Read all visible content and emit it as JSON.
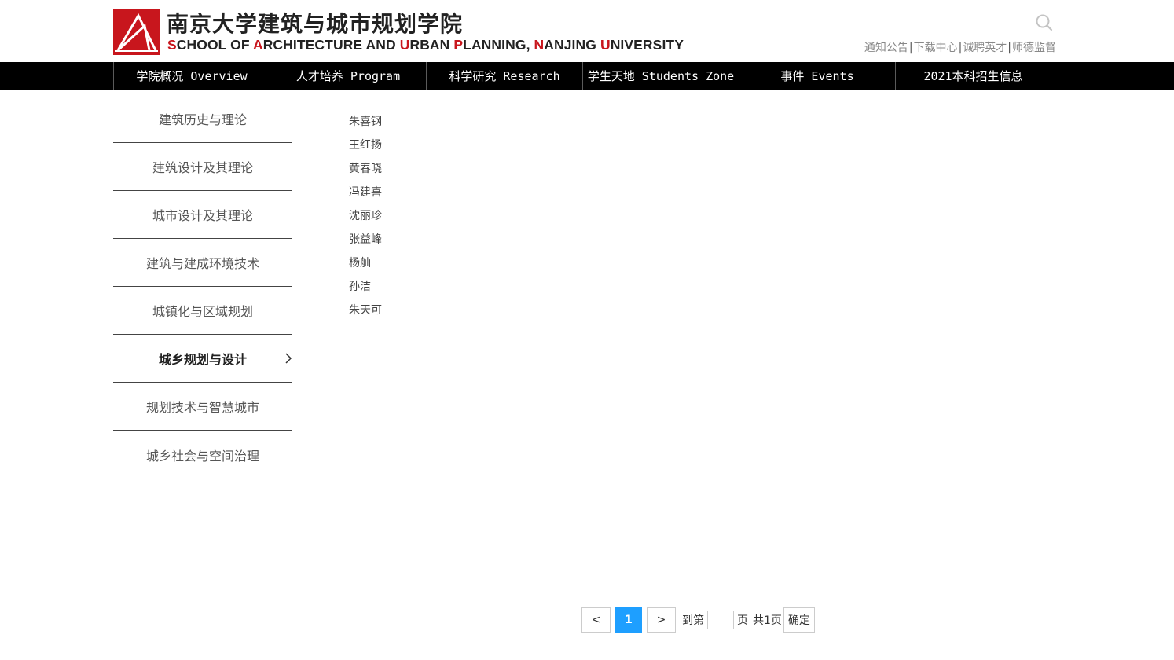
{
  "header": {
    "title_cn": "南京大学建筑与城市规划学院",
    "title_en": {
      "s": "S",
      "p1": "CHOOL OF ",
      "a": "A",
      "p2": "RCHITECTURE AND ",
      "u": "U",
      "p3": "RBAN ",
      "pl": "P",
      "p4": "LANNING, ",
      "n": "N",
      "p5": "ANJING ",
      "un": "U",
      "p6": "NIVERSITY"
    },
    "top_links": [
      "通知公告",
      "下载中心",
      "诚聘英才",
      "师德监督"
    ],
    "separator": "|"
  },
  "nav": {
    "items": [
      "学院概况 Overview",
      "人才培养 Program",
      "科学研究 Research",
      "学生天地 Students Zone",
      "事件 Events",
      "2021本科招生信息"
    ]
  },
  "sidebar": {
    "items": [
      "建筑历史与理论",
      "建筑设计及其理论",
      "城市设计及其理论",
      "建筑与建成环境技术",
      "城镇化与区域规划",
      "城乡规划与设计",
      "规划技术与智慧城市",
      "城乡社会与空间治理"
    ],
    "active_index": 5
  },
  "people": [
    "朱喜钢",
    "王红扬",
    "黄春晓",
    "冯建喜",
    "沈丽珍",
    "张益峰",
    "杨舢",
    "孙洁",
    "朱天可"
  ],
  "pager": {
    "prev": "<",
    "current": "1",
    "next": ">",
    "goto_prefix": "到第",
    "goto_suffix": "页",
    "total": "共1页",
    "confirm": "确定"
  },
  "colors": {
    "brand_red": "#c8161d",
    "nav_bg": "#000000",
    "pager_active": "#1e9fff"
  }
}
